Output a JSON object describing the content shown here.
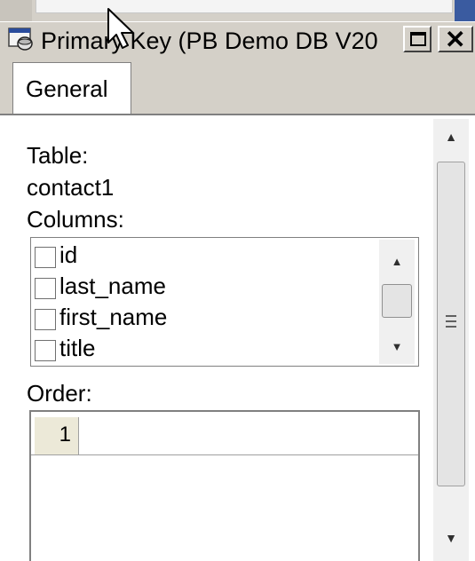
{
  "window": {
    "title": "Primary Key (PB Demo DB V20",
    "maximize_glyph": "",
    "close_glyph": "✕"
  },
  "tabs": [
    {
      "label": "General",
      "selected": true
    }
  ],
  "general": {
    "table_label": "Table:",
    "table_value": "contact1",
    "columns_label": "Columns:",
    "columns": [
      {
        "name": "id",
        "checked": false
      },
      {
        "name": "last_name",
        "checked": false
      },
      {
        "name": "first_name",
        "checked": false
      },
      {
        "name": "title",
        "checked": false
      }
    ],
    "order_label": "Order:",
    "order_rows": [
      {
        "number": "1",
        "value": ""
      }
    ]
  },
  "icons": {
    "title_icon": "primary-key-icon",
    "scroll_up": "▲",
    "scroll_down": "▼",
    "grip": "scroll-grip-icon"
  }
}
